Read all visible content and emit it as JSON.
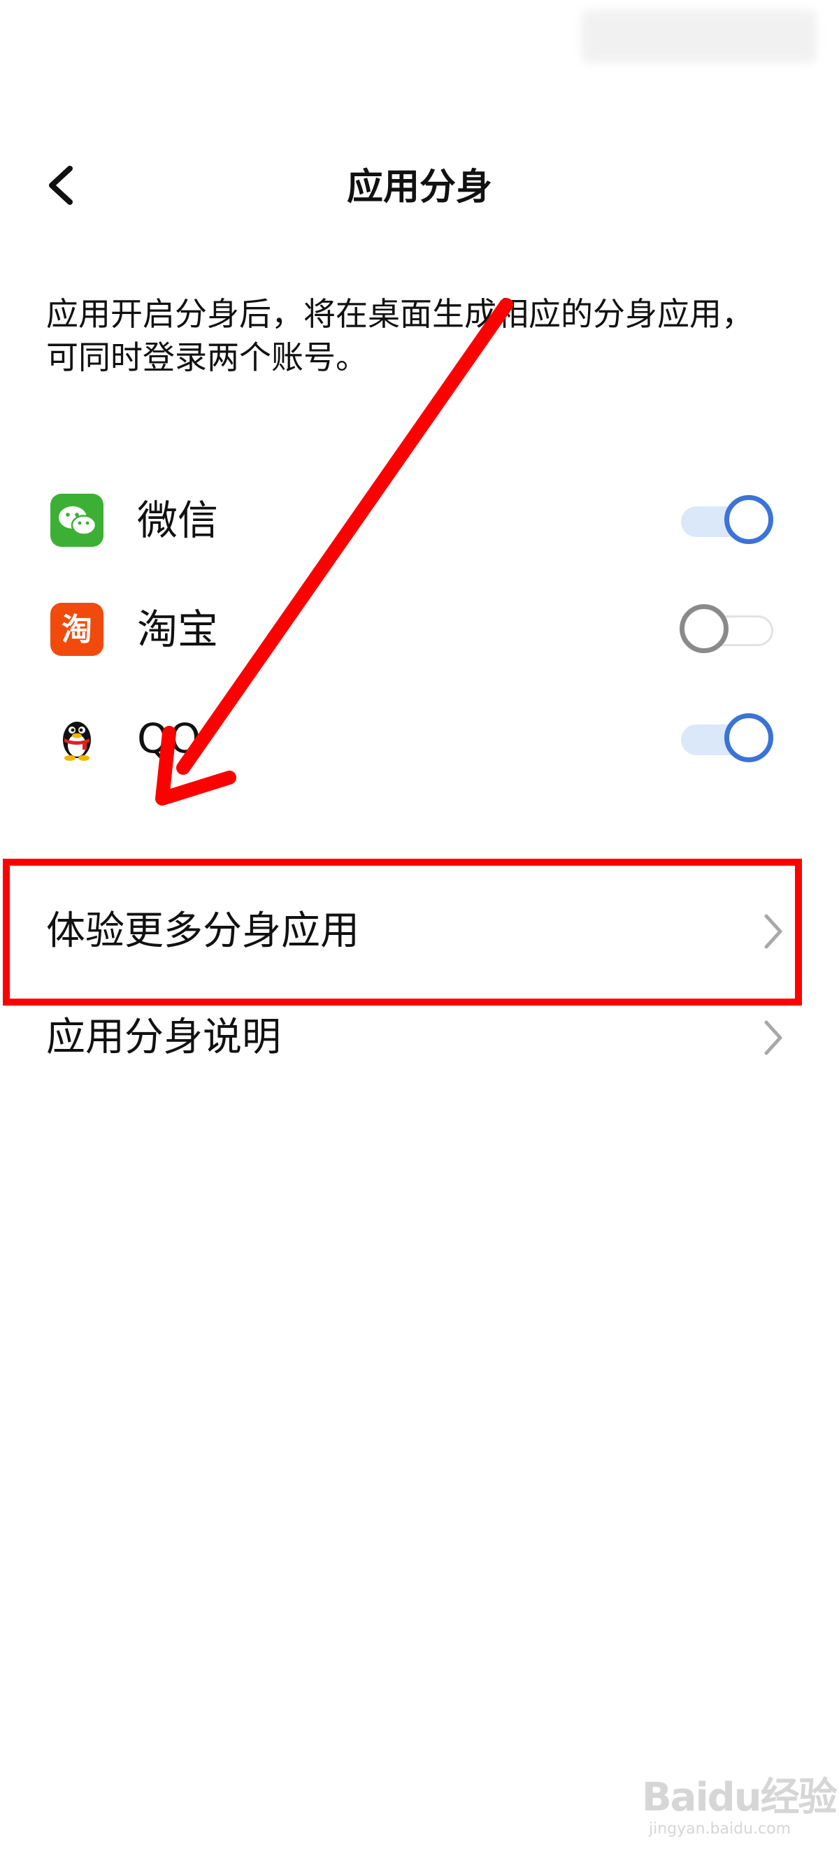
{
  "header": {
    "title": "应用分身",
    "back_icon": "chevron-left-icon"
  },
  "description": "应用开启分身后，将在桌面生成相应的分身应用，可同时登录两个账号。",
  "apps": [
    {
      "name": "微信",
      "icon": "wechat-icon",
      "enabled": true
    },
    {
      "name": "淘宝",
      "icon": "taobao-icon",
      "enabled": false
    },
    {
      "name": "QQ",
      "icon": "qq-icon",
      "enabled": true
    }
  ],
  "links": [
    {
      "label": "体验更多分身应用",
      "icon": "chevron-right-icon"
    },
    {
      "label": "应用分身说明",
      "icon": "chevron-right-icon"
    }
  ],
  "colors": {
    "accent": "#3b73d6",
    "annotation": "#ff0000",
    "wechat": "#3cb035",
    "taobao": "#f24a0c"
  },
  "watermark": {
    "brand": "Baidu经验",
    "url": "jingyan.baidu.com"
  }
}
